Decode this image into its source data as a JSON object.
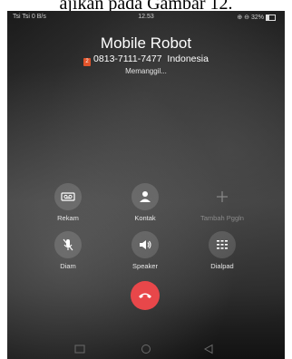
{
  "caption": "ajikan pada Gambar 12.",
  "status_bar": {
    "left": "Tsi Tsi 0 B/s",
    "time": "12.53",
    "right": "⊕ ⊖ 32%"
  },
  "call": {
    "contact_name": "Mobile Robot",
    "sim_label": "2",
    "number": "0813-7111-7477",
    "country": "Indonesia",
    "status": "Memanggil..."
  },
  "actions": [
    {
      "label": "Rekam",
      "icon": "record-icon"
    },
    {
      "label": "Kontak",
      "icon": "contact-icon"
    },
    {
      "label": "Tambah Pggln",
      "icon": "add-call-icon"
    },
    {
      "label": "Diam",
      "icon": "mute-icon"
    },
    {
      "label": "Speaker",
      "icon": "speaker-icon"
    },
    {
      "label": "Dialpad",
      "icon": "dialpad-icon"
    }
  ],
  "end_call_color": "#e8474a",
  "nav": [
    "recents-icon",
    "home-icon",
    "back-icon"
  ]
}
